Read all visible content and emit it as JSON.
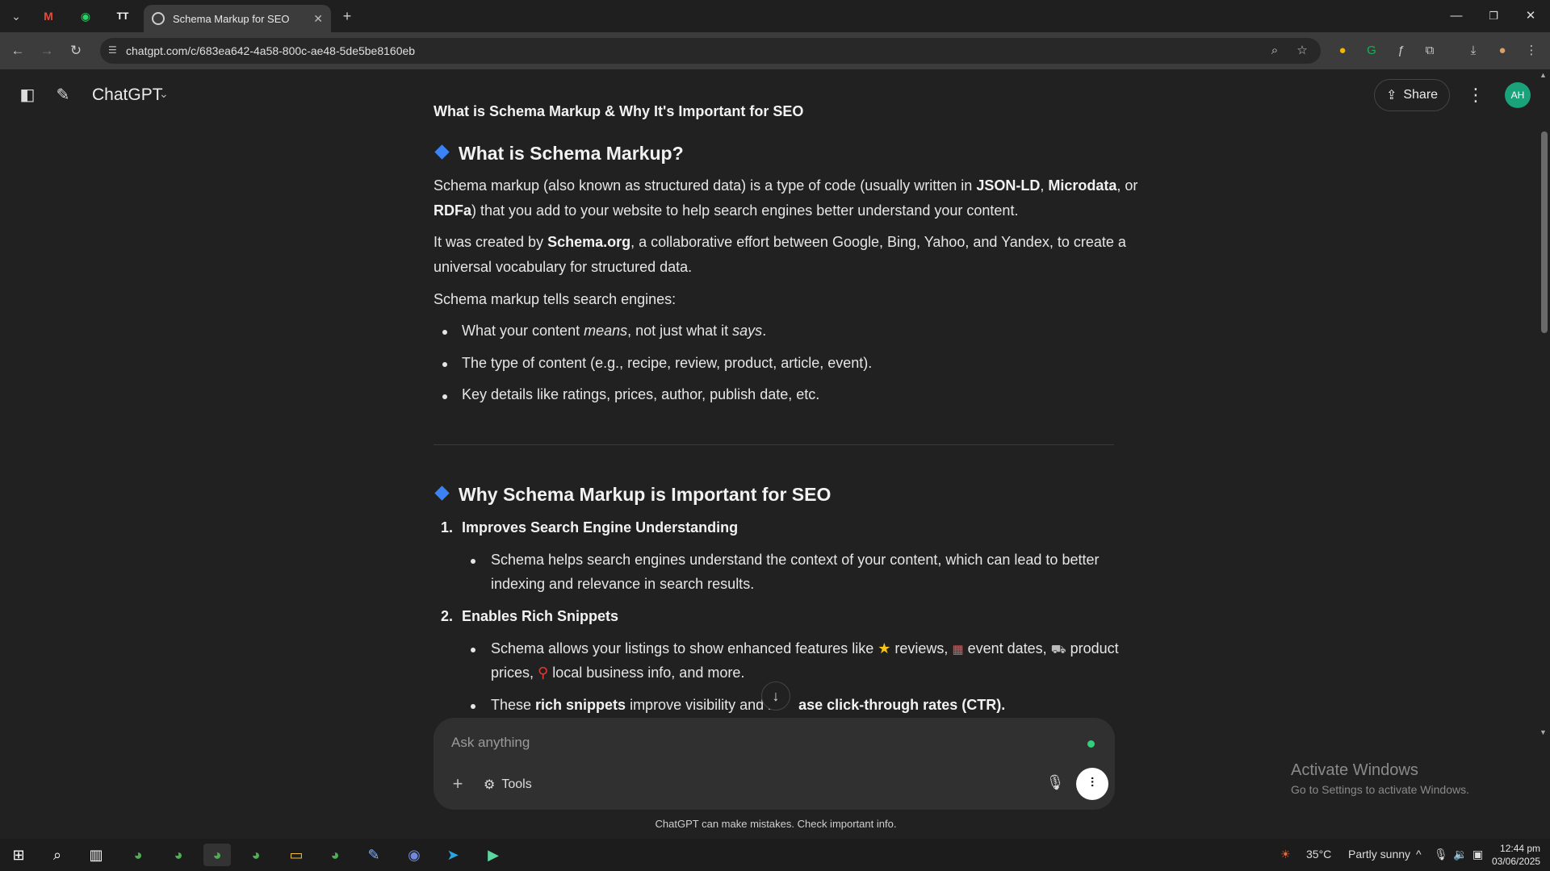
{
  "browser": {
    "active_tab_title": "Schema Markup for SEO",
    "url": "chatgpt.com/c/683ea642-4a58-800c-ae48-5de5be8160eb",
    "other_tab_icons": [
      "gmail-icon",
      "whatsapp-icon",
      "tiktok-icon"
    ]
  },
  "header": {
    "model": "ChatGPT",
    "share_label": "Share",
    "avatar_initials": "AH"
  },
  "content": {
    "title": "What is Schema Markup & Why It's Important for SEO",
    "section1": {
      "heading": "What is Schema Markup?",
      "p1": {
        "a": "Schema markup (also known as structured data) is a type of code (usually written in ",
        "b1": "JSON-LD",
        "c": ", ",
        "b2": "Microdata",
        "d": ", or",
        "line2_b": "RDFa",
        "line2_e": ") that you add to your website to help search engines better understand your content."
      },
      "p2": {
        "a": "It was created by ",
        "b": "Schema.org",
        "c": ", a collaborative effort between Google, Bing, Yahoo, and Yandex, to create a",
        "line2": "universal vocabulary for structured data."
      },
      "p3": "Schema markup tells search engines:",
      "bullets": [
        {
          "a": "What your content ",
          "i1": "means",
          "b": ", not just what it ",
          "i2": "says",
          "c": "."
        },
        {
          "text": "The type of content (e.g., recipe, review, product, article, event)."
        },
        {
          "text": "Key details like ratings, prices, author, publish date, etc."
        }
      ]
    },
    "section2": {
      "heading": "Why Schema Markup is Important for SEO",
      "items": [
        {
          "number": "1.",
          "title": "Improves Search Engine Understanding",
          "line1": "Schema helps search engines understand the context of your content, which can lead to better",
          "line2": "indexing and relevance in search results."
        },
        {
          "number": "2.",
          "title": "Enables Rich Snippets",
          "line1_a": "Schema allows your listings to show enhanced features like ",
          "line1_b": " reviews, ",
          "line1_c": " event dates, ",
          "line1_d": " product",
          "line2_a": "prices, ",
          "line2_b": " local business info, and more.",
          "line3_a": "These ",
          "line3_b": "rich snippets",
          "line3_c": " improve visibility and in",
          "line3_d": "ase click-through rates (CTR)."
        }
      ]
    }
  },
  "composer": {
    "placeholder": "Ask anything",
    "tools_label": "Tools"
  },
  "disclaimer": "ChatGPT can make mistakes. Check important info.",
  "watermark": {
    "line1": "Activate Windows",
    "line2": "Go to Settings to activate Windows."
  },
  "taskbar": {
    "weather_temp": "35°C",
    "weather_text": "Partly sunny",
    "time": "12:44 pm",
    "date": "03/06/2025"
  }
}
